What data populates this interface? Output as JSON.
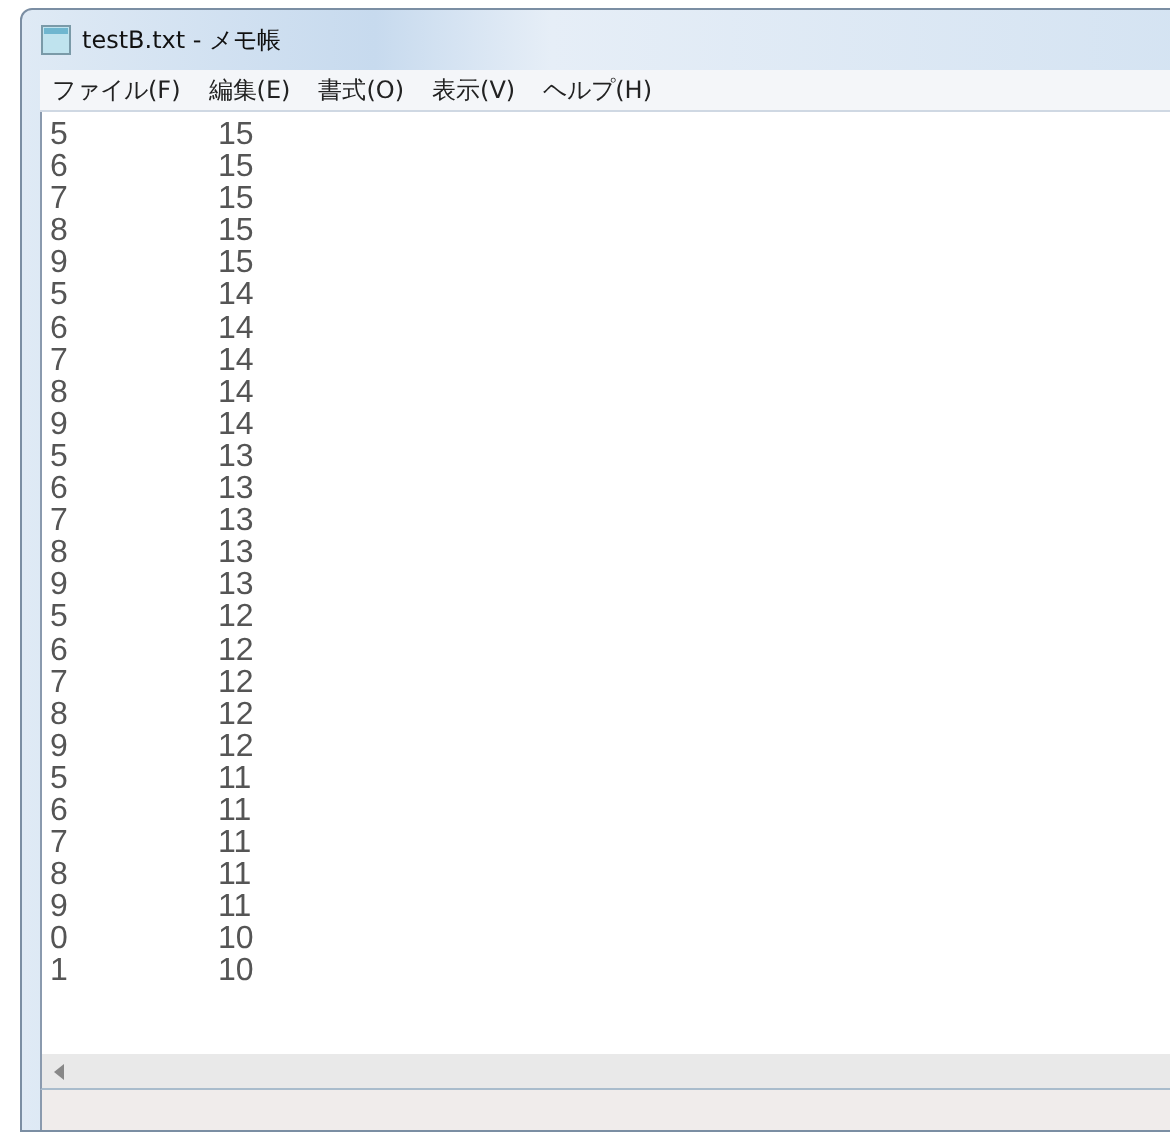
{
  "window": {
    "title": "testB.txt - メモ帳"
  },
  "menu": [
    "ファイル(F)",
    "編集(E)",
    "書式(O)",
    "表示(V)",
    "ヘルプ(H)"
  ],
  "lines": [
    {
      "column_1": "5",
      "column_2": "15"
    },
    {
      "column_1": "6",
      "column_2": "15"
    },
    {
      "column_1": "7",
      "column_2": "15"
    },
    {
      "column_1": "8",
      "column_2": "15"
    },
    {
      "column_1": "9",
      "column_2": "15"
    },
    {
      "column_1": "5",
      "column_2": "14"
    },
    {
      "column_1": "6",
      "column_2": "14"
    },
    {
      "column_1": "7",
      "column_2": "14"
    },
    {
      "column_1": "8",
      "column_2": "14"
    },
    {
      "column_1": "9",
      "column_2": "14"
    },
    {
      "column_1": "5",
      "column_2": "13"
    },
    {
      "column_1": "6",
      "column_2": "13"
    },
    {
      "column_1": "7",
      "column_2": "13"
    },
    {
      "column_1": "8",
      "column_2": "13"
    },
    {
      "column_1": "9",
      "column_2": "13"
    },
    {
      "column_1": "5",
      "column_2": "12"
    },
    {
      "column_1": "6",
      "column_2": "12"
    },
    {
      "column_1": "7",
      "column_2": "12"
    },
    {
      "column_1": "8",
      "column_2": "12"
    },
    {
      "column_1": "9",
      "column_2": "12"
    },
    {
      "column_1": "5",
      "column_2": "11"
    },
    {
      "column_1": "6",
      "column_2": "11"
    },
    {
      "column_1": "7",
      "column_2": "11"
    },
    {
      "column_1": "8",
      "column_2": "11"
    },
    {
      "column_1": "9",
      "column_2": "11"
    },
    {
      "column_1": "0",
      "column_2": "10"
    },
    {
      "column_1": "1",
      "column_2": "10"
    }
  ]
}
